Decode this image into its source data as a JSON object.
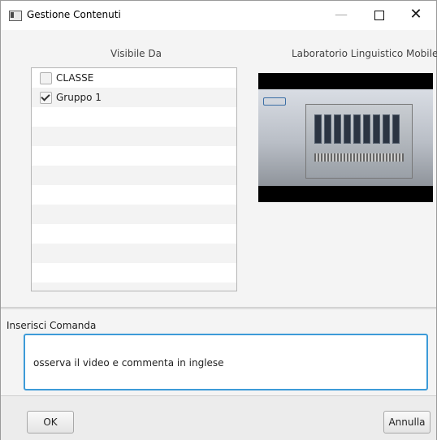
{
  "window": {
    "title": "Gestione Contenuti"
  },
  "left_panel": {
    "header": "Visibile Da",
    "items": [
      {
        "label": "CLASSE",
        "checked": false
      },
      {
        "label": "Gruppo 1",
        "checked": true
      }
    ]
  },
  "right_panel": {
    "header": "Laboratorio Linguistico Mobile"
  },
  "command": {
    "label": "Inserisci Comanda",
    "value": "osserva il video e commenta in inglese"
  },
  "buttons": {
    "ok": "OK",
    "cancel": "Annulla"
  }
}
